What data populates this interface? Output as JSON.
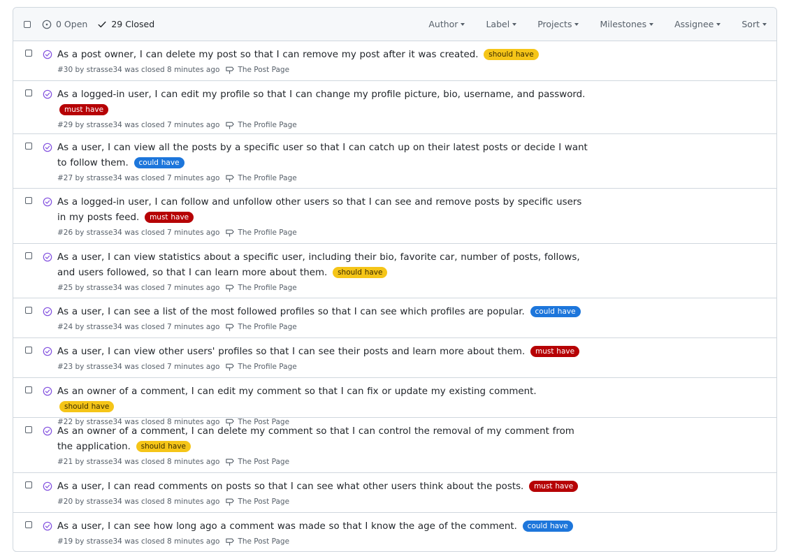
{
  "header": {
    "open_label": "0 Open",
    "closed_label": "29 Closed",
    "filters": [
      "Author",
      "Label",
      "Projects",
      "Milestones",
      "Assignee",
      "Sort"
    ]
  },
  "issues": [
    {
      "title": "As a post owner, I can delete my post so that I can remove my post after it was created.",
      "label": "should have",
      "number": "#30",
      "meta": "by strasse34 was closed 8 minutes ago",
      "milestone": "The Post Page"
    },
    {
      "title": "As a logged-in user, I can edit my profile so that I can change my profile picture, bio, username, and password.",
      "label": "must have",
      "number": "#29",
      "meta": "by strasse34 was closed 7 minutes ago",
      "milestone": "The Profile Page"
    },
    {
      "title": "As a user, I can view all the posts by a specific user so that I can catch up on their latest posts or decide I want to follow them.",
      "label": "could have",
      "number": "#27",
      "meta": "by strasse34 was closed 7 minutes ago",
      "milestone": "The Profile Page"
    },
    {
      "title": "As a logged-in user, I can follow and unfollow other users so that I can see and remove posts by specific users in my posts feed.",
      "label": "must have",
      "number": "#26",
      "meta": "by strasse34 was closed 7 minutes ago",
      "milestone": "The Profile Page"
    },
    {
      "title": "As a user, I can view statistics about a specific user, including their bio, favorite car, number of posts, follows, and users followed, so that I can learn more about them.",
      "label": "should have",
      "number": "#25",
      "meta": "by strasse34 was closed 7 minutes ago",
      "milestone": "The Profile Page"
    },
    {
      "title": "As a user, I can see a list of the most followed profiles so that I can see which profiles are popular.",
      "label": "could have",
      "number": "#24",
      "meta": "by strasse34 was closed 7 minutes ago",
      "milestone": "The Profile Page"
    },
    {
      "title": "As a user, I can view other users' profiles so that I can see their posts and learn more about them.",
      "label": "must have",
      "number": "#23",
      "meta": "by strasse34 was closed 7 minutes ago",
      "milestone": "The Profile Page"
    },
    {
      "title": "As an owner of a comment, I can edit my comment so that I can fix or update my existing comment.",
      "label": "should have",
      "number": "#22",
      "meta": "by strasse34 was closed 8 minutes ago",
      "milestone": "The Post Page"
    },
    {
      "title": "As an owner of a comment, I can delete my comment so that I can control the removal of my comment from the application.",
      "label": "should have",
      "number": "#21",
      "meta": "by strasse34 was closed 8 minutes ago",
      "milestone": "The Post Page"
    },
    {
      "title": "As a user, I can read comments on posts so that I can see what other users think about the posts.",
      "label": "must have",
      "number": "#20",
      "meta": "by strasse34 was closed 8 minutes ago",
      "milestone": "The Post Page"
    },
    {
      "title": "As a user, I can see how long ago a comment was made so that I know the age of the comment.",
      "label": "could have",
      "number": "#19",
      "meta": "by strasse34 was closed 8 minutes ago",
      "milestone": "The Post Page"
    }
  ]
}
